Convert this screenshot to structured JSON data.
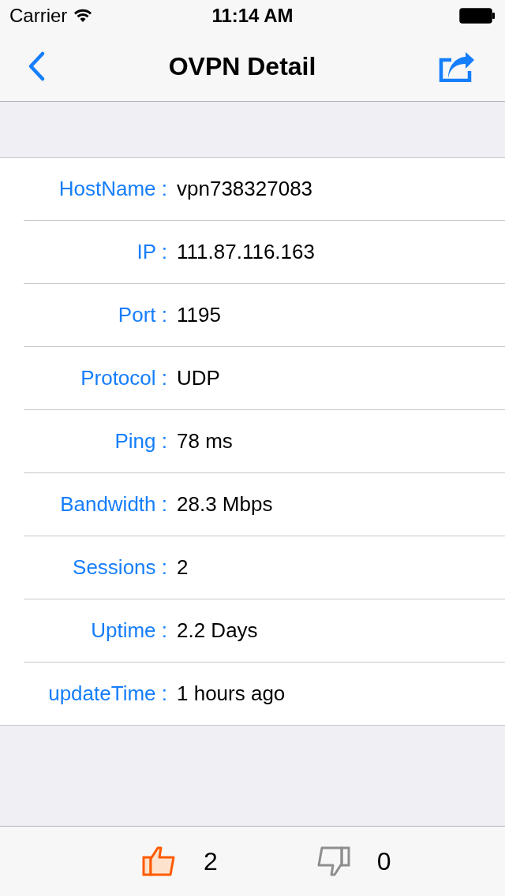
{
  "status_bar": {
    "carrier": "Carrier",
    "time": "11:14 AM"
  },
  "nav_bar": {
    "title": "OVPN Detail"
  },
  "details": [
    {
      "label": "HostName :",
      "value": "vpn738327083"
    },
    {
      "label": "IP :",
      "value": "111.87.116.163"
    },
    {
      "label": "Port :",
      "value": "1195"
    },
    {
      "label": "Protocol :",
      "value": "UDP"
    },
    {
      "label": "Ping :",
      "value": "78 ms"
    },
    {
      "label": "Bandwidth :",
      "value": "28.3 Mbps"
    },
    {
      "label": "Sessions :",
      "value": "2"
    },
    {
      "label": "Uptime :",
      "value": "2.2 Days"
    },
    {
      "label": "updateTime :",
      "value": "1 hours ago"
    }
  ],
  "votes": [
    {
      "kind": "up",
      "count": "2",
      "selected": true
    },
    {
      "kind": "down",
      "count": "0",
      "selected": false
    }
  ]
}
